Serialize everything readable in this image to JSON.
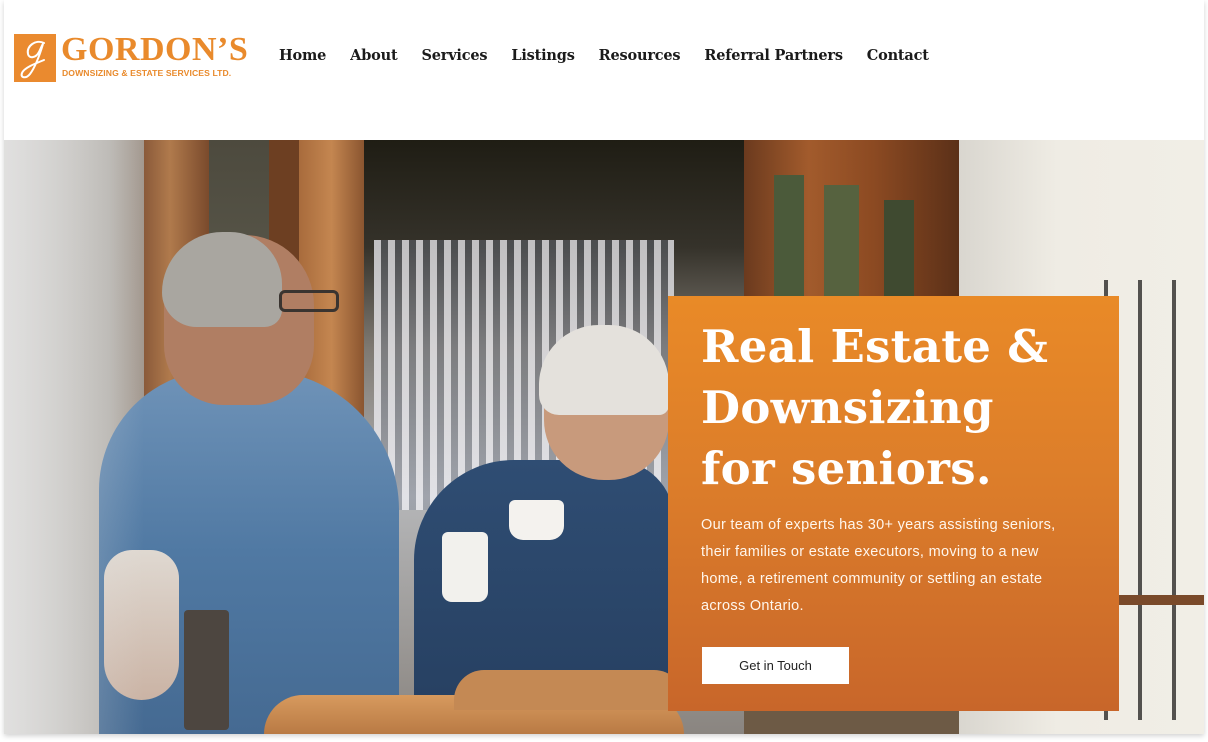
{
  "brand": {
    "name": "GORDON’S",
    "tagline": "DOWNSIZING & ESTATE SERVICES LTD.",
    "monogram": "g",
    "color": "#e98a2c"
  },
  "nav": {
    "items": [
      {
        "label": "Home"
      },
      {
        "label": "About"
      },
      {
        "label": "Services"
      },
      {
        "label": "Listings"
      },
      {
        "label": "Resources"
      },
      {
        "label": "Referral Partners"
      },
      {
        "label": "Contact"
      }
    ]
  },
  "hero": {
    "image_alt": "Senior couple smiling and drinking coffee at a cafe table",
    "title_lines": [
      "Real Estate &",
      "Downsizing",
      "for seniors."
    ],
    "description": "Our team of experts has 30+ years assisting seniors, their families or estate executors, moving to a new home, a retirement community or settling an estate across Ontario.",
    "cta_label": "Get in Touch",
    "card_color_top": "#e98a27",
    "card_color_bottom": "#c8662a"
  }
}
